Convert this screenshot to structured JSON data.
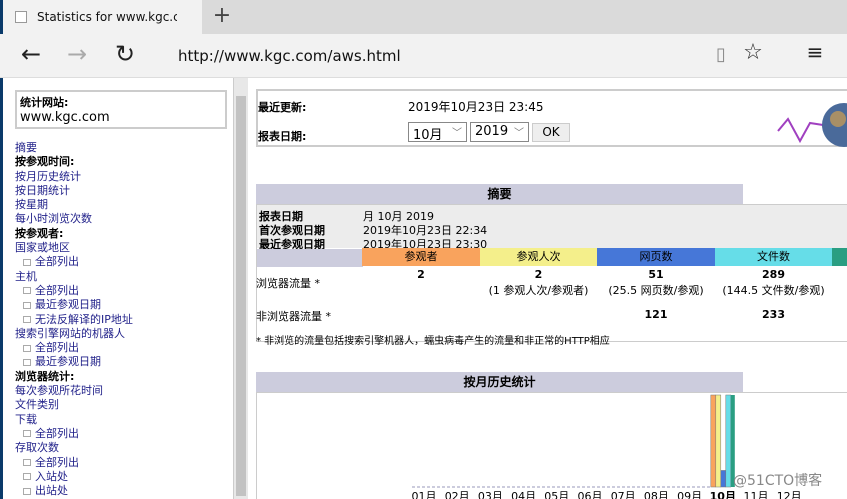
{
  "browser": {
    "tab_title": "Statistics for www.kgc.co",
    "url": "http://www.kgc.com/aws.html"
  },
  "sidebar": {
    "site_label": "统计网站:",
    "site": "www.kgc.com",
    "items": [
      {
        "t": "摘要",
        "k": "link"
      },
      {
        "t": "按参观时间:",
        "k": "h"
      },
      {
        "t": "按月历史统计",
        "k": "link"
      },
      {
        "t": "按日期统计",
        "k": "link"
      },
      {
        "t": "按星期",
        "k": "link"
      },
      {
        "t": "每小时浏览次数",
        "k": "link"
      },
      {
        "t": "按参观者:",
        "k": "h"
      },
      {
        "t": "国家或地区",
        "k": "link"
      },
      {
        "t": "全部列出",
        "k": "sub"
      },
      {
        "t": "主机",
        "k": "link"
      },
      {
        "t": "全部列出",
        "k": "sub"
      },
      {
        "t": "最近参观日期",
        "k": "sub"
      },
      {
        "t": "无法反解译的IP地址",
        "k": "sub"
      },
      {
        "t": "搜索引擎网站的机器人",
        "k": "link"
      },
      {
        "t": "全部列出",
        "k": "sub"
      },
      {
        "t": "最近参观日期",
        "k": "sub"
      },
      {
        "t": "浏览器统计:",
        "k": "h"
      },
      {
        "t": "每次参观所花时间",
        "k": "link"
      },
      {
        "t": "文件类别",
        "k": "link"
      },
      {
        "t": "下载",
        "k": "link"
      },
      {
        "t": "全部列出",
        "k": "sub"
      },
      {
        "t": "存取次数",
        "k": "link"
      },
      {
        "t": "全部列出",
        "k": "sub"
      },
      {
        "t": "入站处",
        "k": "sub"
      },
      {
        "t": "出站处",
        "k": "sub"
      }
    ]
  },
  "top": {
    "updated_label": "最近更新:",
    "updated": "2019年10月23日 23:45",
    "date_label": "报表日期:",
    "month": "10月",
    "year": "2019",
    "ok": "OK"
  },
  "summary": {
    "title": "摘要",
    "rows": [
      [
        "报表日期",
        "月 10月 2019"
      ],
      [
        "首次参观日期",
        "2019年10月23日 22:34"
      ],
      [
        "最近参观日期",
        "2019年10月23日 23:30"
      ]
    ],
    "cols": [
      "参观者",
      "参观人次",
      "网页数",
      "文件数"
    ],
    "browser_label": "浏览器流量 *",
    "browser_vals": [
      "2",
      "2",
      "51",
      "289"
    ],
    "browser_sub": [
      "",
      "(1 参观人次/参观者)",
      "(25.5 网页数/参观)",
      "(144.5 文件数/参观)"
    ],
    "nonbrowser_label": "非浏览器流量 *",
    "nonbrowser_vals": [
      "121",
      "233"
    ],
    "note": "* 非浏览的流量包括搜索引擎机器人，蠕虫病毒产生的流量和非正常的HTTP相应"
  },
  "colors": {
    "visitors": "#f9a35d",
    "visits": "#f4ef8b",
    "pages": "#4677d8",
    "hits": "#66dde8",
    "bytes": "#2a9e82"
  },
  "watermark": "@51CTO博客",
  "chart_data": {
    "type": "bar",
    "title": "按月历史统计",
    "categories": [
      "01月",
      "02月",
      "03月",
      "04月",
      "05月",
      "06月",
      "07月",
      "08月",
      "09月",
      "10月",
      "11月",
      "12月"
    ],
    "current": "10月",
    "series": [
      {
        "name": "参观者",
        "values": [
          0,
          0,
          0,
          0,
          0,
          0,
          0,
          0,
          0,
          2,
          0,
          0
        ]
      },
      {
        "name": "参观人次",
        "values": [
          0,
          0,
          0,
          0,
          0,
          0,
          0,
          0,
          0,
          2,
          0,
          0
        ]
      },
      {
        "name": "网页数",
        "values": [
          0,
          0,
          0,
          0,
          0,
          0,
          0,
          0,
          0,
          51,
          0,
          0
        ]
      },
      {
        "name": "文件数",
        "values": [
          0,
          0,
          0,
          0,
          0,
          0,
          0,
          0,
          0,
          289,
          0,
          0
        ]
      }
    ]
  }
}
